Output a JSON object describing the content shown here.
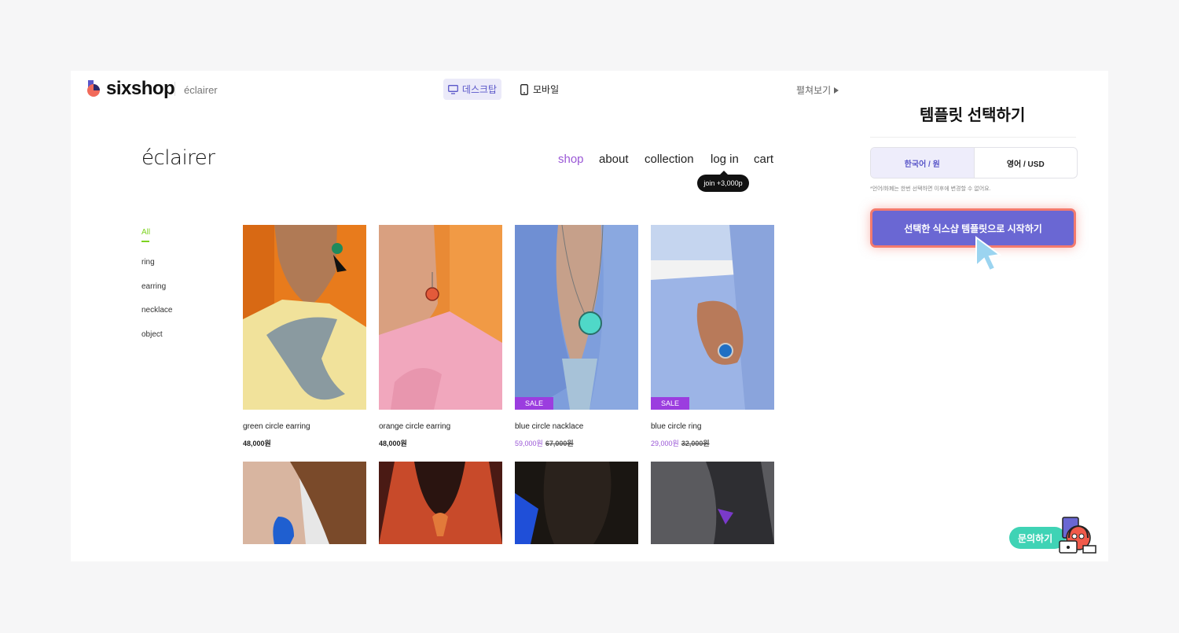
{
  "topbar": {
    "brand": "sixshop",
    "store_name": "éclairer",
    "view_desktop": "데스크탑",
    "view_mobile": "모바일",
    "expand": "펼쳐보기"
  },
  "shop": {
    "logo": "éclairer",
    "nav": [
      "shop",
      "about",
      "collection",
      "log in",
      "cart"
    ],
    "tooltip": "join +3,000p",
    "categories": [
      "All",
      "ring",
      "earring",
      "necklace",
      "object"
    ],
    "products": [
      {
        "name": "green circle earring",
        "price": "48,000원",
        "sale_badge": "",
        "orig_price": ""
      },
      {
        "name": "orange circle earring",
        "price": "48,000원",
        "sale_badge": "",
        "orig_price": ""
      },
      {
        "name": "blue circle nacklace",
        "price": "59,000원",
        "sale_badge": "SALE",
        "orig_price": "67,000원"
      },
      {
        "name": "blue circle ring",
        "price": "29,000원",
        "sale_badge": "SALE",
        "orig_price": "32,000원"
      }
    ]
  },
  "panel": {
    "title": "템플릿 선택하기",
    "lang_korean": "한국어 / 원",
    "lang_english": "영어 / USD",
    "note": "*언어/화폐는 한번 선택하면 이후에 변경할 수 없어요.",
    "start_button": "선택한 식스샵 템플릿으로 시작하기",
    "inquiry": "문의하기"
  },
  "colors": {
    "accent": "#6a67d3",
    "highlight_border": "#f37a6e",
    "nav_active": "#9a57d6",
    "category_active": "#7ed321",
    "sale": "#9b3ddf",
    "inquiry": "#3fd3b5"
  }
}
